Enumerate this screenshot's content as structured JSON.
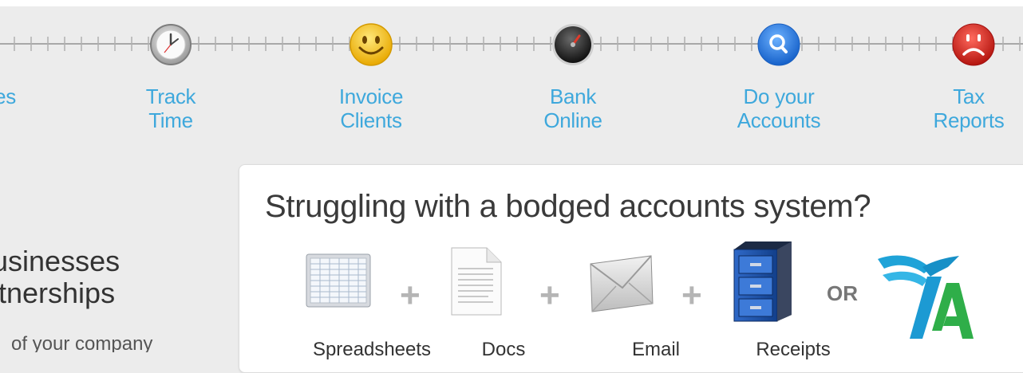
{
  "timeline": {
    "steps": [
      {
        "line1": "",
        "line2": "es",
        "icon": "partial-icon"
      },
      {
        "line1": "Track",
        "line2": "Time",
        "icon": "clock-icon"
      },
      {
        "line1": "Invoice",
        "line2": "Clients",
        "icon": "smiley-icon"
      },
      {
        "line1": "Bank",
        "line2": "Online",
        "icon": "gauge-icon"
      },
      {
        "line1": "Do your",
        "line2": "Accounts",
        "icon": "search-icon"
      },
      {
        "line1": "Tax",
        "line2": "Reports",
        "icon": "sad-face-icon"
      }
    ]
  },
  "left": {
    "heading_line1": "usinesses",
    "heading_line2": "rtnerships",
    "subtext": "of your company"
  },
  "promo": {
    "title": "Struggling with a bodged accounts system?",
    "tools": [
      {
        "label": "Spreadsheets",
        "icon": "spreadsheet-icon"
      },
      {
        "label": "Docs",
        "icon": "document-icon"
      },
      {
        "label": "Email",
        "icon": "envelope-icon"
      },
      {
        "label": "Receipts",
        "icon": "filing-cabinet-icon"
      }
    ],
    "plus": "+",
    "or": "OR",
    "logo": "winged-fa-logo"
  },
  "colors": {
    "accent_blue": "#3ea8dc",
    "smiley_yellow": "#f6c419",
    "search_blue": "#2f7fe0",
    "sad_red": "#d8261f",
    "plus_gray": "#b5b5b5"
  }
}
